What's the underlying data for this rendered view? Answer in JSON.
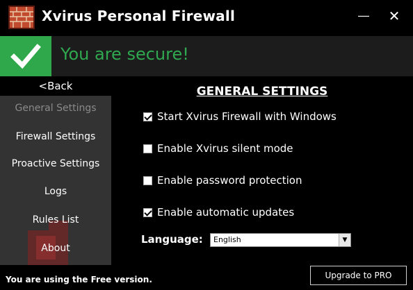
{
  "window": {
    "title": "Xvirus Personal Firewall",
    "logo_icon": "brick-wall-icon",
    "minimize_label": "―",
    "close_label": "✕"
  },
  "status": {
    "icon": "check-icon",
    "text": "You are secure!",
    "color": "#2ea84a"
  },
  "nav": {
    "back_label": "<Back",
    "items": [
      {
        "label": "General Settings",
        "active": true
      },
      {
        "label": "Firewall Settings",
        "active": false
      },
      {
        "label": "Proactive Settings",
        "active": false
      },
      {
        "label": "Logs",
        "active": false
      },
      {
        "label": "Rules List",
        "active": false
      },
      {
        "label": "About",
        "active": false
      }
    ]
  },
  "settings": {
    "title": "GENERAL SETTINGS",
    "options": [
      {
        "label": "Start Xvirus Firewall with Windows",
        "checked": true
      },
      {
        "label": "Enable Xvirus silent mode",
        "checked": false
      },
      {
        "label": "Enable password protection",
        "checked": false
      },
      {
        "label": "Enable automatic updates",
        "checked": true
      }
    ],
    "language_label": "Language:",
    "language_value": "English"
  },
  "footer": {
    "version_text": "You are using the Free version.",
    "upgrade_label": "Upgrade to PRO"
  }
}
